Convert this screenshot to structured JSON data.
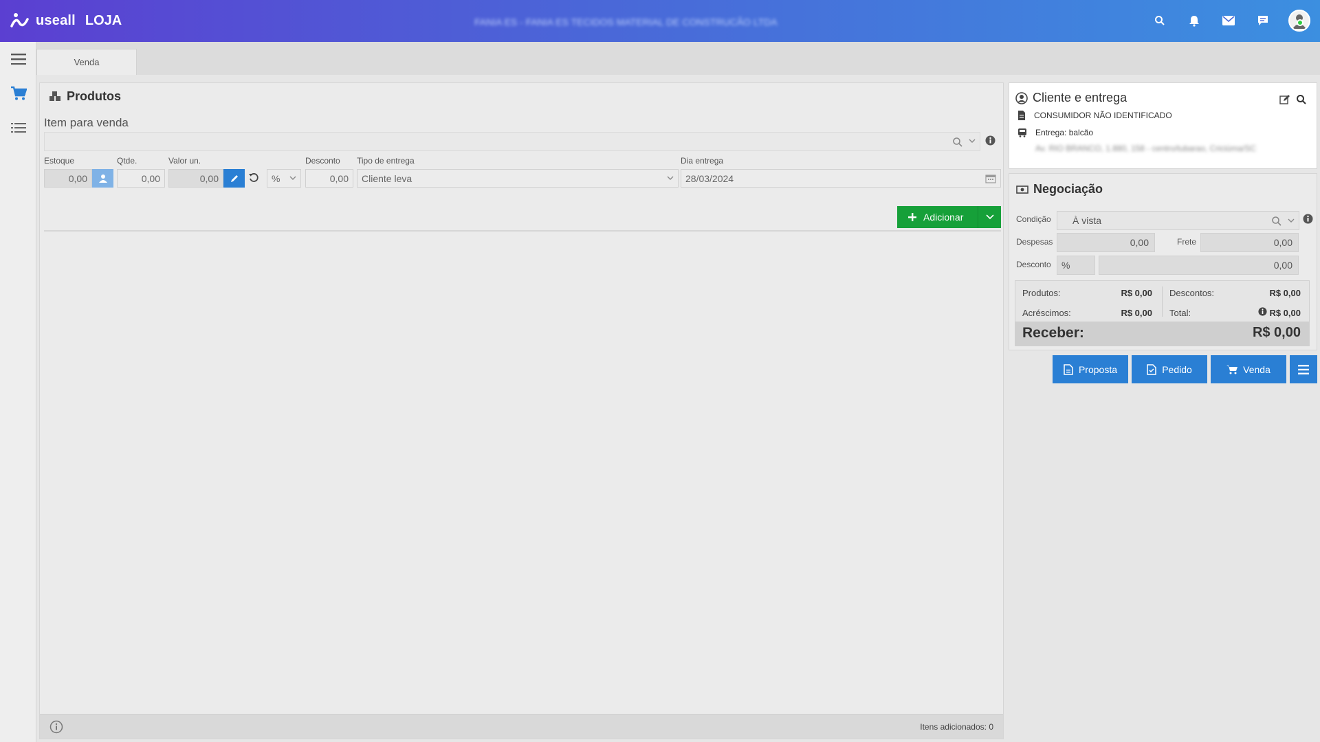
{
  "app": {
    "brand": "useall",
    "module": "LOJA",
    "window_title": "FANIA ES - FANIA ES TECIDOS MATERIAL DE CONSTRUCÃO LTDA"
  },
  "tabs": [
    {
      "label": "Venda"
    }
  ],
  "produtos": {
    "title": "Produtos",
    "item_label": "Item para venda",
    "item_search_value": "",
    "fields": {
      "estoque_label": "Estoque",
      "estoque_value": "0,00",
      "qtde_label": "Qtde.",
      "qtde_value": "0,00",
      "valor_label": "Valor un.",
      "valor_value": "0,00",
      "pct_value": "%",
      "desconto_label": "Desconto",
      "desconto_value": "0,00",
      "tipo_label": "Tipo de entrega",
      "tipo_value": "Cliente leva",
      "dia_label": "Dia entrega",
      "dia_value": "28/03/2024"
    },
    "add_button": "Adicionar",
    "footer_count": "Itens adicionados: 0"
  },
  "cliente": {
    "title": "Cliente e entrega",
    "name": "CONSUMIDOR NÃO IDENTIFICADO",
    "entrega": "Entrega: balcão",
    "address": "Av. RIO BRANCO, 1.880, 158 - centro/tubarao, Criciúma/SC"
  },
  "negociacao": {
    "title": "Negociação",
    "condicao_label": "Condição",
    "condicao_value": "À vista",
    "despesas_label": "Despesas",
    "despesas_value": "0,00",
    "frete_label": "Frete",
    "frete_value": "0,00",
    "desconto_label": "Desconto",
    "desconto_pct": "%",
    "desconto_value": "0,00",
    "summary": {
      "produtos_label": "Produtos:",
      "produtos_value": "R$ 0,00",
      "descontos_label": "Descontos:",
      "descontos_value": "R$ 0,00",
      "acrescimos_label": "Acréscimos:",
      "acrescimos_value": "R$ 0,00",
      "total_label": "Total:",
      "total_value": "R$ 0,00",
      "receber_label": "Receber:",
      "receber_value": "R$ 0,00"
    }
  },
  "actions": {
    "proposta": "Proposta",
    "pedido": "Pedido",
    "venda": "Venda"
  },
  "colors": {
    "primary": "#2a7fd4",
    "success": "#16a039",
    "header_start": "#5b3fd1",
    "header_end": "#3c8fe0"
  }
}
